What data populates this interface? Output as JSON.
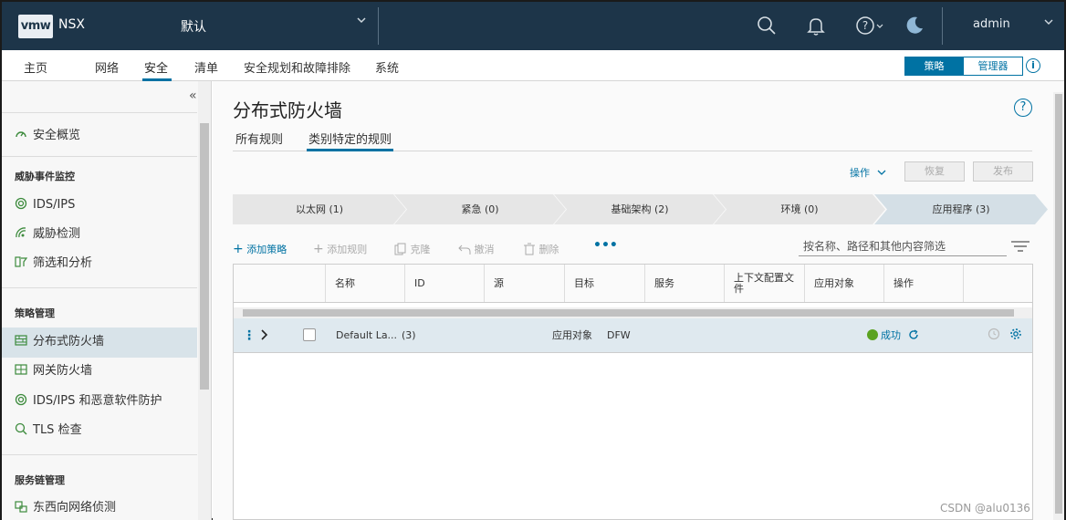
{
  "header": {
    "logo": "vmw",
    "product": "NSX",
    "project": "默认",
    "user": "admin"
  },
  "nav": {
    "items": [
      "主页",
      "网络",
      "安全",
      "清单",
      "安全规划和故障排除",
      "系统"
    ],
    "active": "安全",
    "mode_policy": "策略",
    "mode_manager": "管理器"
  },
  "sidebar": {
    "overview": "安全概览",
    "threat_section": "威胁事件监控",
    "ids_ips": "IDS/IPS",
    "threat_detect": "威胁检测",
    "filter_analyze": "筛选和分析",
    "policy_section": "策略管理",
    "dfw": "分布式防火墙",
    "gateway_fw": "网关防火墙",
    "ids_malware": "IDS/IPS 和恶意软件防护",
    "tls": "TLS 检查",
    "service_chain_section": "服务链管理",
    "ew_detect": "东西向网络侦测"
  },
  "main": {
    "title": "分布式防火墙",
    "tabs": [
      "所有规则",
      "类别特定的规则"
    ],
    "active_tab": "类别特定的规则",
    "actions_label": "操作",
    "revert_label": "恢复",
    "publish_label": "发布",
    "categories": [
      "以太网 (1)",
      "紧急 (0)",
      "基础架构 (2)",
      "环境 (0)",
      "应用程序 (3)"
    ],
    "active_category": "应用程序 (3)",
    "toolbar": {
      "add_policy": "添加策略",
      "add_rule": "添加规则",
      "clone": "克隆",
      "undo": "撤消",
      "delete": "删除",
      "more": "•••"
    },
    "filter_placeholder": "按名称、路径和其他内容筛选"
  },
  "grid": {
    "columns": [
      "名称",
      "ID",
      "源",
      "目标",
      "服务",
      "上下文配置文件",
      "应用对象",
      "操作"
    ],
    "row": {
      "name": "Default La...",
      "count": "(3)",
      "applied_to": "应用对象",
      "applied_value": "DFW",
      "status": "成功"
    }
  },
  "watermark": "CSDN @alu0136",
  "colors": {
    "topbar": "#1d3549",
    "accent": "#0072a3",
    "success": "#5aa220",
    "selected_row": "#dfe9ef"
  }
}
